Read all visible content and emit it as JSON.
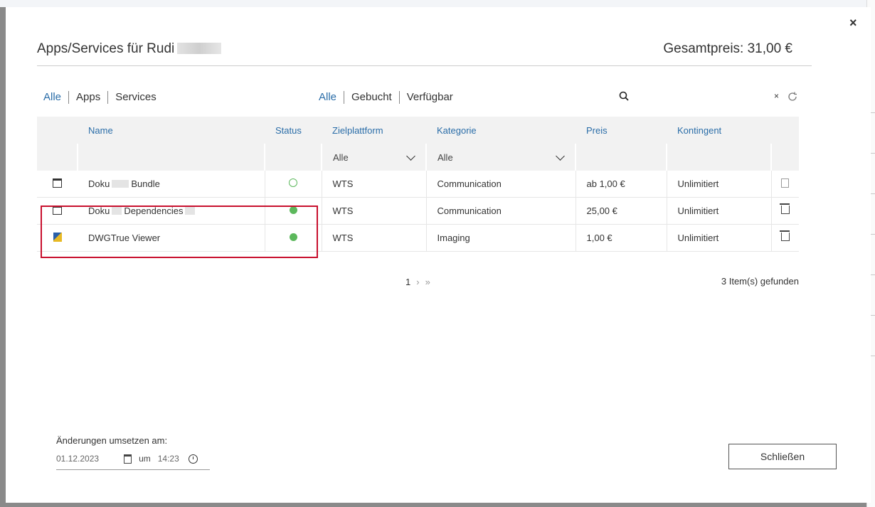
{
  "dialog": {
    "title": "Apps/Services für Rudi",
    "total_price": "Gesamtpreis: 31,00 €",
    "close_glyph": "×"
  },
  "type_filter": [
    "Alle",
    "Apps",
    "Services"
  ],
  "booking_filter": [
    "Alle",
    "Gebucht",
    "Verfügbar"
  ],
  "search": {
    "value": "",
    "clear_glyph": "×"
  },
  "table": {
    "headers": {
      "name": "Name",
      "status": "Status",
      "platform": "Zielplattform",
      "category": "Kategorie",
      "price": "Preis",
      "quota": "Kontingent"
    },
    "filters": {
      "platform": "Alle",
      "category": "Alle"
    },
    "rows": [
      {
        "name": "Doku Bundle",
        "name_a": "Doku",
        "name_b": "Bundle",
        "status": "inactive",
        "platform": "WTS",
        "category": "Communication",
        "price": "ab 1,00 €",
        "quota": "Unlimitiert",
        "icon": "window-icon",
        "action": "document-icon"
      },
      {
        "name": "Doku Dependencies",
        "name_a": "Doku",
        "name_b": "Dependencies",
        "status": "active",
        "platform": "WTS",
        "category": "Communication",
        "price": "25,00 €",
        "quota": "Unlimitiert",
        "icon": "window-icon",
        "action": "trash-icon"
      },
      {
        "name": "DWGTrue Viewer",
        "name_a": "DWGTrue Viewer",
        "name_b": "",
        "status": "active",
        "platform": "WTS",
        "category": "Imaging",
        "price": "1,00 €",
        "quota": "Unlimitiert",
        "icon": "dwgtrue-icon",
        "action": "trash-icon"
      }
    ]
  },
  "pagination": {
    "current": "1",
    "next": "›",
    "last": "»"
  },
  "result_count": "3 Item(s) gefunden",
  "apply": {
    "label": "Änderungen umsetzen am:",
    "date": "01.12.2023",
    "at": "um",
    "time": "14:23"
  },
  "close_button": "Schließen",
  "colors": {
    "accent": "#2a6da8",
    "active_status": "#5cb85c",
    "highlight": "#c8102e"
  }
}
